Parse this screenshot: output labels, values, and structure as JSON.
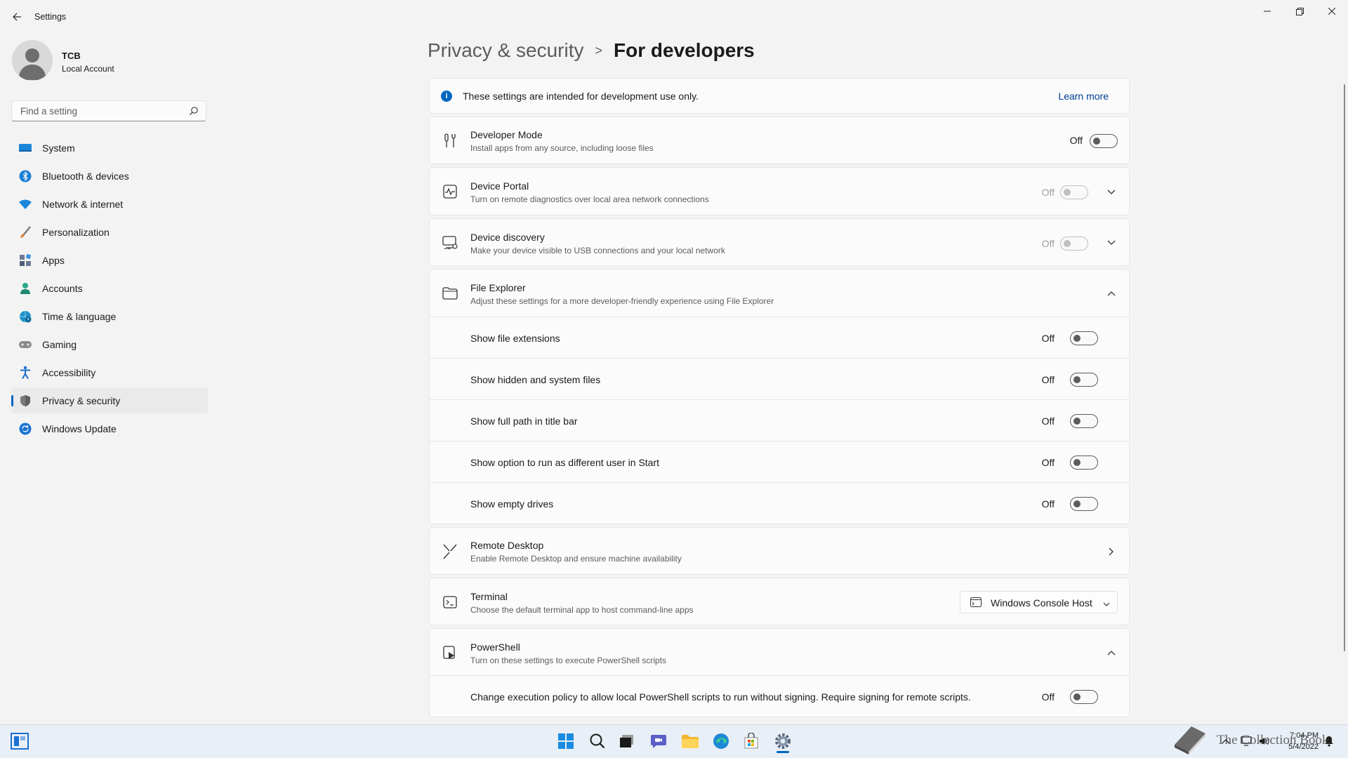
{
  "app": {
    "title": "Settings"
  },
  "user": {
    "name": "TCB",
    "account_type": "Local Account"
  },
  "search": {
    "placeholder": "Find a setting"
  },
  "sidebar": {
    "items": [
      {
        "label": "System",
        "icon": "monitor-icon",
        "color": "#0078d4"
      },
      {
        "label": "Bluetooth & devices",
        "icon": "bluetooth-icon",
        "color": "#0078d4"
      },
      {
        "label": "Network & internet",
        "icon": "wifi-icon",
        "color": "#0078d4"
      },
      {
        "label": "Personalization",
        "icon": "paintbrush-icon",
        "color": "#e3803b"
      },
      {
        "label": "Apps",
        "icon": "apps-icon",
        "color": "#5a6b85"
      },
      {
        "label": "Accounts",
        "icon": "person-icon",
        "color": "#2ea88b"
      },
      {
        "label": "Time & language",
        "icon": "globe-clock-icon",
        "color": "#1e90c8"
      },
      {
        "label": "Gaming",
        "icon": "gamepad-icon",
        "color": "#8a8a8a"
      },
      {
        "label": "Accessibility",
        "icon": "accessibility-icon",
        "color": "#1a6fd1"
      },
      {
        "label": "Privacy & security",
        "icon": "shield-icon",
        "color": "#7a7a7a",
        "active": true
      },
      {
        "label": "Windows Update",
        "icon": "update-icon",
        "color": "#1a73d1"
      }
    ]
  },
  "header": {
    "parent": "Privacy & security",
    "separator": ">",
    "current": "For developers"
  },
  "info": {
    "text": "These settings are intended for development use only.",
    "link": "Learn more"
  },
  "settings": {
    "developer_mode": {
      "title": "Developer Mode",
      "desc": "Install apps from any source, including loose files",
      "state": "Off"
    },
    "device_portal": {
      "title": "Device Portal",
      "desc": "Turn on remote diagnostics over local area network connections",
      "state": "Off"
    },
    "device_discovery": {
      "title": "Device discovery",
      "desc": "Make your device visible to USB connections and your local network",
      "state": "Off"
    },
    "file_explorer": {
      "title": "File Explorer",
      "desc": "Adjust these settings for a more developer-friendly experience using File Explorer",
      "options": [
        {
          "label": "Show file extensions",
          "state": "Off"
        },
        {
          "label": "Show hidden and system files",
          "state": "Off"
        },
        {
          "label": "Show full path in title bar",
          "state": "Off"
        },
        {
          "label": "Show option to run as different user in Start",
          "state": "Off"
        },
        {
          "label": "Show empty drives",
          "state": "Off"
        }
      ]
    },
    "remote_desktop": {
      "title": "Remote Desktop",
      "desc": "Enable Remote Desktop and ensure machine availability"
    },
    "terminal": {
      "title": "Terminal",
      "desc": "Choose the default terminal app to host command-line apps",
      "selected": "Windows Console Host"
    },
    "powershell": {
      "title": "PowerShell",
      "desc": "Turn on these settings to execute PowerShell scripts",
      "option": {
        "label": "Change execution policy to allow local PowerShell scripts to run without signing. Require signing for remote scripts.",
        "state": "Off"
      }
    }
  },
  "taskbar": {
    "watermark": "The Collection Book",
    "time": "7:04 PM",
    "date": "5/4/2022"
  },
  "colors": {
    "accent": "#0067c0",
    "background": "#f3f3f3",
    "card": "#fbfbfb"
  }
}
